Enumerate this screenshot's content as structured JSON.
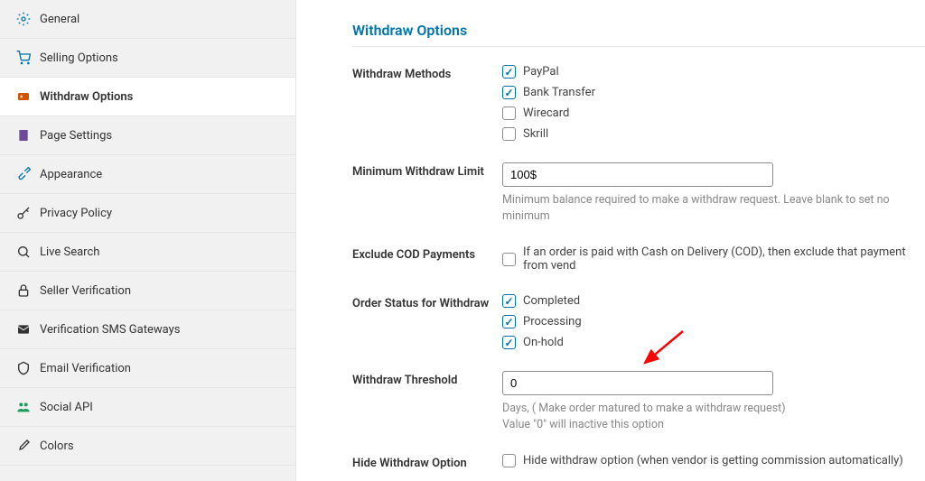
{
  "section_title": "Withdraw Options",
  "sidebar": {
    "items": [
      {
        "label": "General"
      },
      {
        "label": "Selling Options"
      },
      {
        "label": "Withdraw Options"
      },
      {
        "label": "Page Settings"
      },
      {
        "label": "Appearance"
      },
      {
        "label": "Privacy Policy"
      },
      {
        "label": "Live Search"
      },
      {
        "label": "Seller Verification"
      },
      {
        "label": "Verification SMS Gateways"
      },
      {
        "label": "Email Verification"
      },
      {
        "label": "Social API"
      },
      {
        "label": "Colors"
      }
    ]
  },
  "fields": {
    "withdraw_methods": {
      "label": "Withdraw Methods",
      "options": [
        {
          "label": "PayPal"
        },
        {
          "label": "Bank Transfer"
        },
        {
          "label": "Wirecard"
        },
        {
          "label": "Skrill"
        }
      ]
    },
    "min_limit": {
      "label": "Minimum Withdraw Limit",
      "value": "100$",
      "help": "Minimum balance required to make a withdraw request. Leave blank to set no minimum"
    },
    "exclude_cod": {
      "label": "Exclude COD Payments",
      "option_label": "If an order is paid with Cash on Delivery (COD), then exclude that payment from vend"
    },
    "order_status": {
      "label": "Order Status for Withdraw",
      "options": [
        {
          "label": "Completed"
        },
        {
          "label": "Processing"
        },
        {
          "label": "On-hold"
        }
      ]
    },
    "threshold": {
      "label": "Withdraw Threshold",
      "value": "0",
      "help1": "Days, ( Make order matured to make a withdraw request)",
      "help2": "Value \"0\" will inactive this option"
    },
    "hide_option": {
      "label": "Hide Withdraw Option",
      "option_label": "Hide withdraw option (when vendor is getting commission automatically)"
    }
  }
}
